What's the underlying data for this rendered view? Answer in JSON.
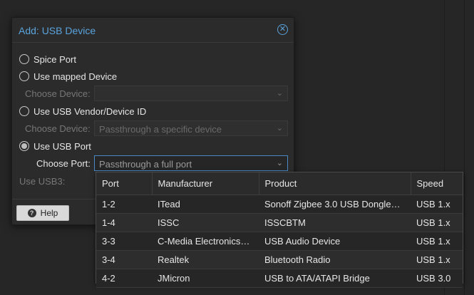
{
  "dialog": {
    "title": "Add: USB Device",
    "close_icon": "close-circle-icon",
    "options": {
      "spice_port": "Spice Port",
      "mapped_device": "Use mapped Device",
      "vendor_id": "Use USB Vendor/Device ID",
      "usb_port": "Use USB Port"
    },
    "fields": {
      "choose_device_label": "Choose Device:",
      "choose_device_value": "",
      "choose_device2_label": "Choose Device:",
      "choose_device2_placeholder": "Passthrough a specific device",
      "choose_port_label": "Choose Port:",
      "choose_port_placeholder": "Passthrough a full port",
      "usb3_label": "Use USB3:"
    },
    "selected_option": "usb_port",
    "help_label": "Help",
    "help_icon": "question-circle-icon"
  },
  "port_table": {
    "headers": {
      "port": "Port",
      "manufacturer": "Manufacturer",
      "product": "Product",
      "speed": "Speed"
    },
    "rows": [
      {
        "port": "1-2",
        "manufacturer": "ITead",
        "product": "Sonoff Zigbee 3.0 USB Dongle…",
        "speed": "USB 1.x"
      },
      {
        "port": "1-4",
        "manufacturer": "ISSC",
        "product": "ISSCBTM",
        "speed": "USB 1.x"
      },
      {
        "port": "3-3",
        "manufacturer": "C-Media Electronics…",
        "product": "USB Audio Device",
        "speed": "USB 1.x"
      },
      {
        "port": "3-4",
        "manufacturer": "Realtek",
        "product": "Bluetooth Radio",
        "speed": "USB 1.x"
      },
      {
        "port": "4-2",
        "manufacturer": "JMicron",
        "product": "USB to ATA/ATAPI Bridge",
        "speed": "USB 3.0"
      }
    ]
  },
  "colors": {
    "accent": "#5aa3dc",
    "background": "#262626"
  }
}
